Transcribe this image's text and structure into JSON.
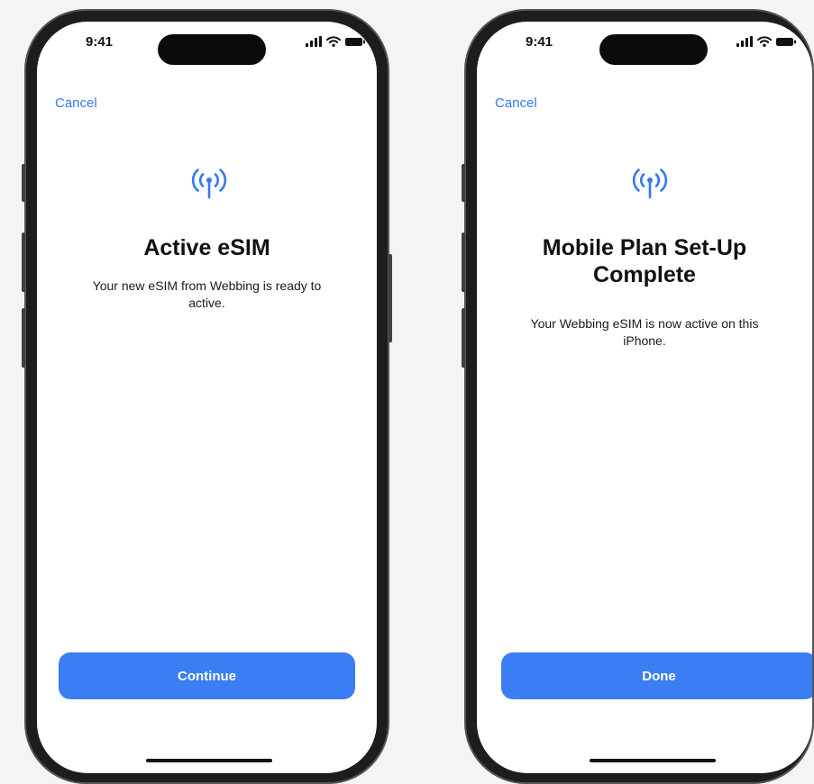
{
  "screens": [
    {
      "status_time": "9:41",
      "cancel_label": "Cancel",
      "title": "Active eSIM",
      "description": "Your new eSIM from Webbing is ready to active.",
      "button_label": "Continue"
    },
    {
      "status_time": "9:41",
      "cancel_label": "Cancel",
      "title": "Mobile Plan Set-Up Complete",
      "description": "Your Webbing eSIM is now active on this iPhone.",
      "button_label": "Done"
    }
  ],
  "icons": {
    "signal": "cellular-signal-icon",
    "wifi": "wifi-icon",
    "battery": "battery-icon",
    "antenna": "antenna-icon"
  },
  "colors": {
    "accent": "#3478f6",
    "button": "#3b7df3",
    "background": "#f3f4f3",
    "phone_frame": "#1d1d1f"
  }
}
